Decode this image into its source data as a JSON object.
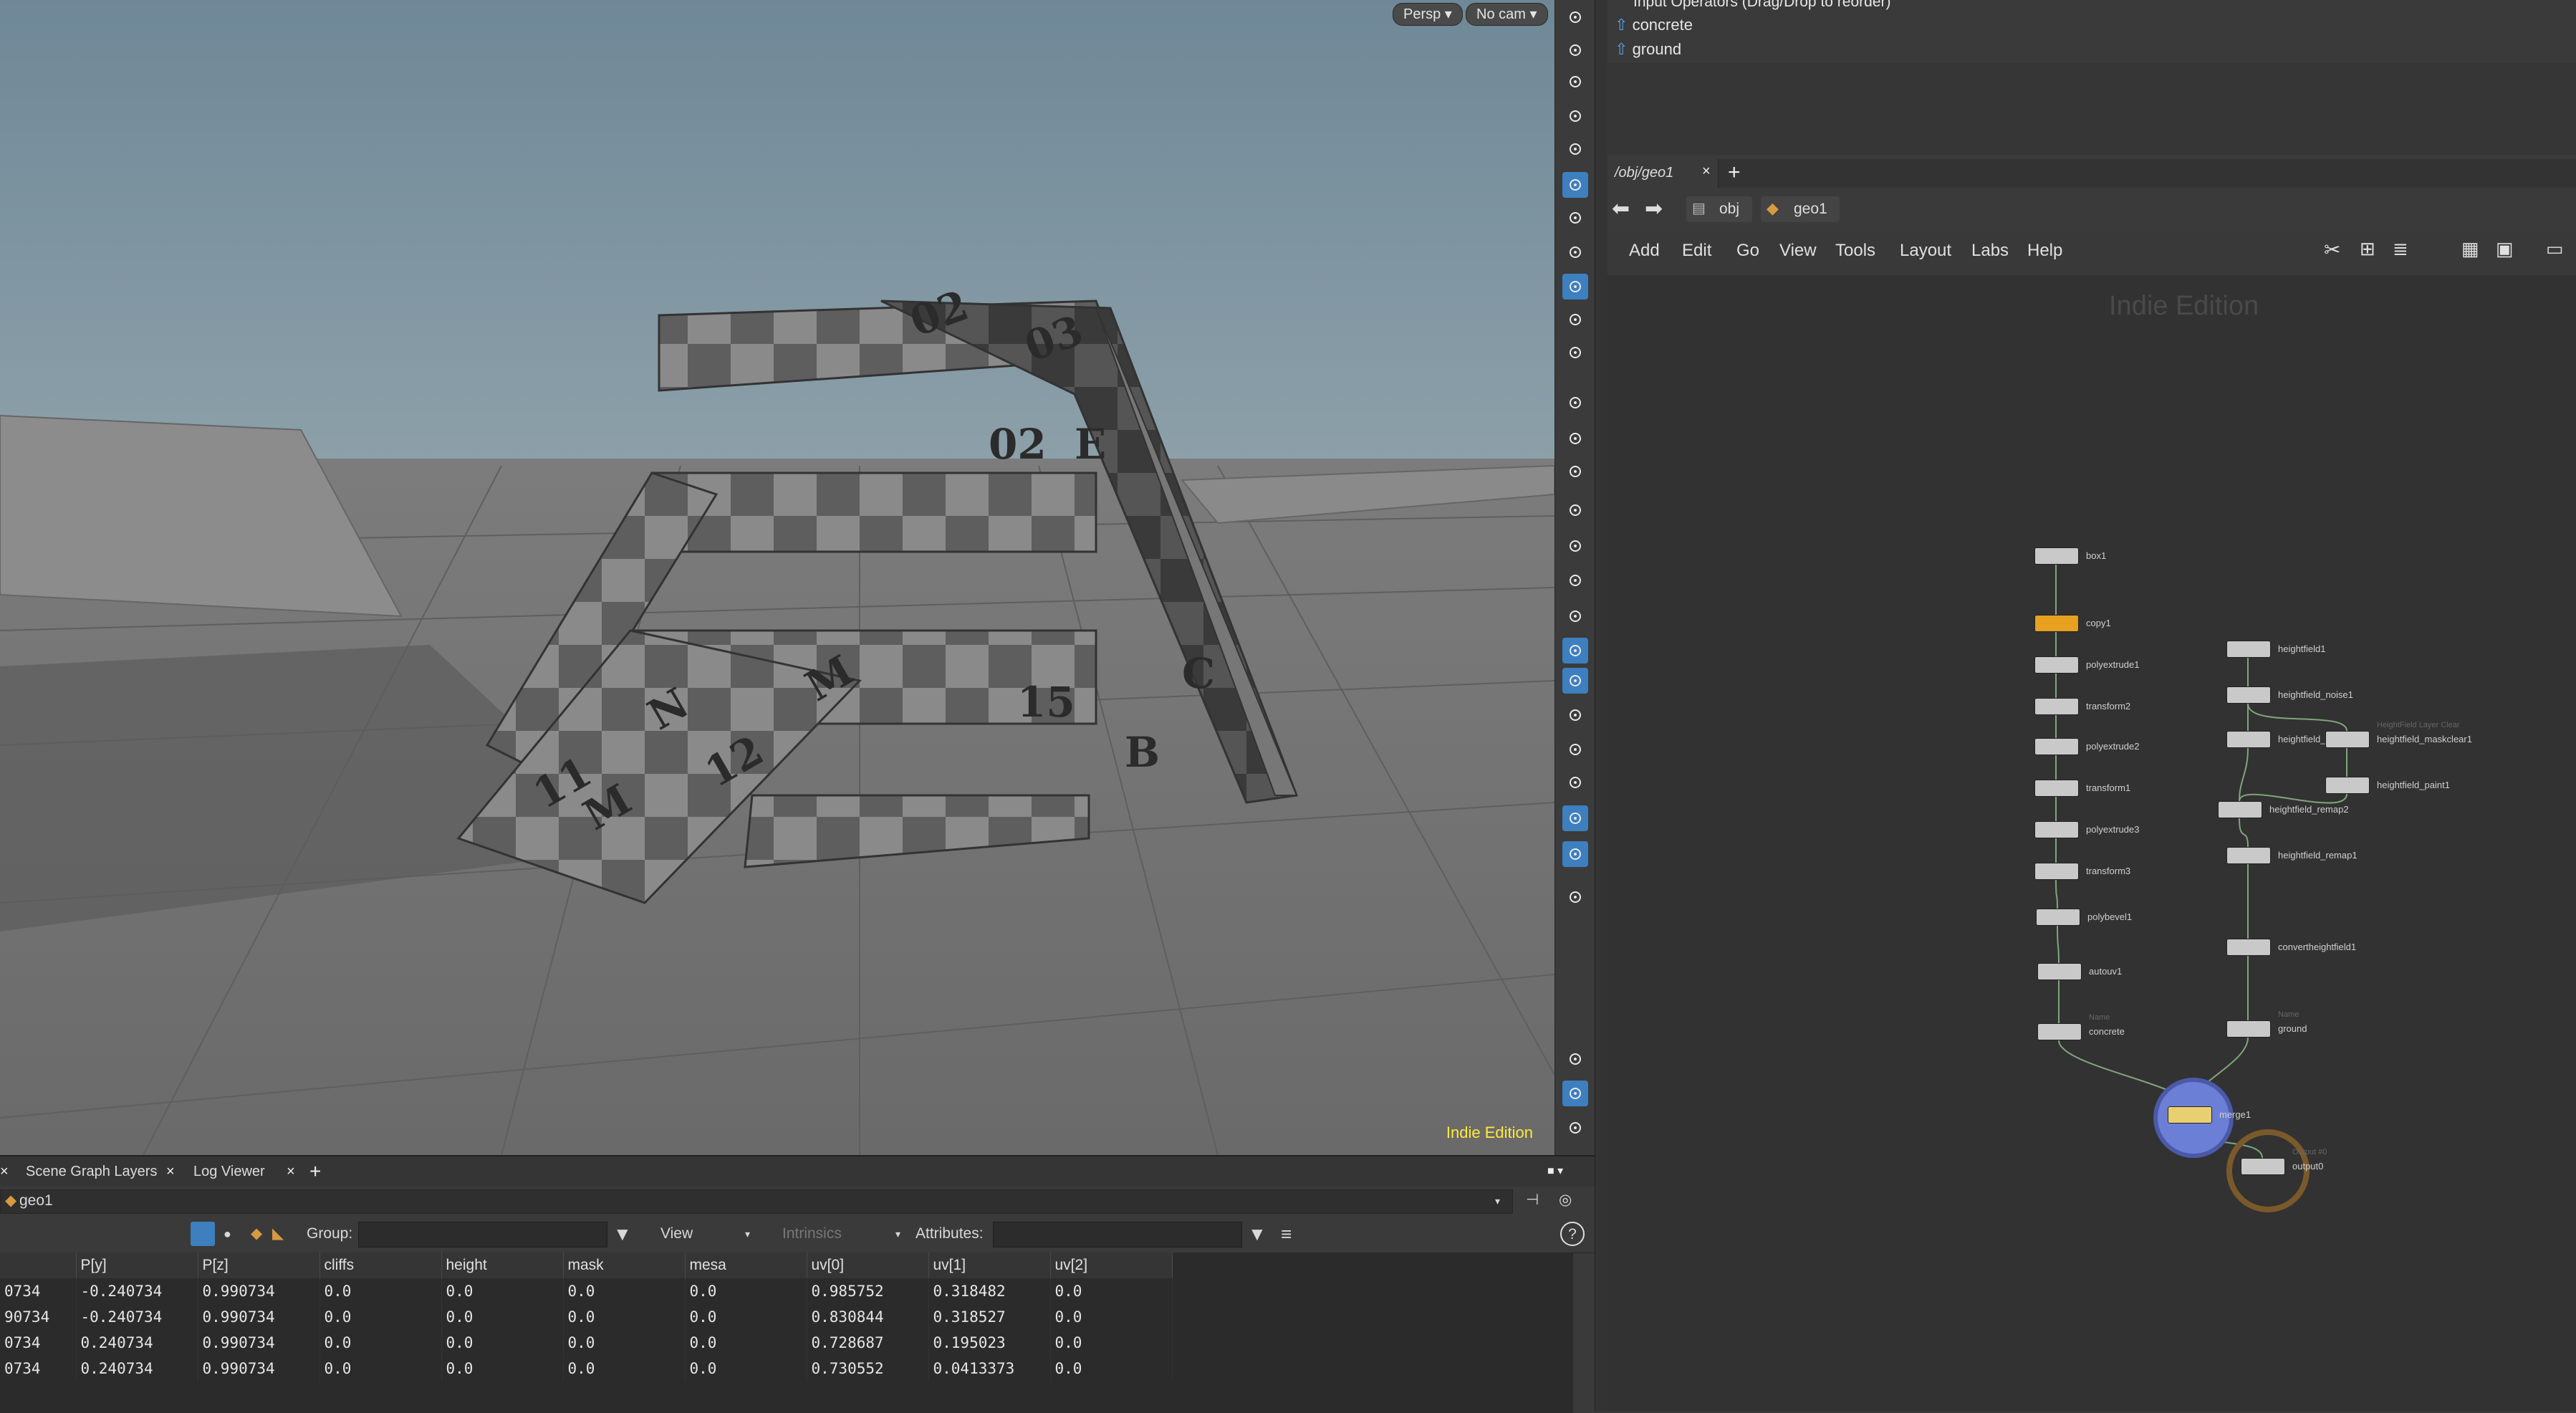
{
  "viewport": {
    "camera_persp": "Persp",
    "camera_nocam": "No cam",
    "watermark": "Indie Edition"
  },
  "toolbar_icons": [
    "view-tool-icon",
    "select-tool-icon",
    "lock-icon",
    "close-circle-icon",
    "ghost-icon",
    "bulb-icon",
    "light-icon",
    "headlight-icon",
    "camera-icon",
    "camera-view-icon",
    "camera-flag-icon",
    "point-icon",
    "brush-icon",
    "pen-icon",
    "numbered-points-icon",
    "primitive-icon",
    "numbered-prims-icon",
    "angle-icon",
    "shading-icon",
    "checker-icon",
    "solid-icon",
    "texture-icon",
    "paint-icon",
    "layers-icon",
    "background-icon",
    "pin-icon",
    "info-icon",
    "grid-layout-icon",
    "eye-icon"
  ],
  "bottom_panel": {
    "tabs": [
      {
        "label": "Scene Graph Layers"
      },
      {
        "label": "Log Viewer"
      }
    ],
    "path": "geo1",
    "group_label": "Group:",
    "view_label": "View",
    "intrinsics_label": "Intrinsics",
    "attributes_label": "Attributes:",
    "columns": [
      "",
      "P[y]",
      "P[z]",
      "cliffs",
      "height",
      "mask",
      "mesa",
      "uv[0]",
      "uv[1]",
      "uv[2]"
    ],
    "rows": [
      [
        "0734",
        "-0.240734",
        "0.990734",
        "0.0",
        "0.0",
        "0.0",
        "0.0",
        "0.985752",
        "0.318482",
        "0.0"
      ],
      [
        "90734",
        "-0.240734",
        "0.990734",
        "0.0",
        "0.0",
        "0.0",
        "0.0",
        "0.830844",
        "0.318527",
        "0.0"
      ],
      [
        "0734",
        "0.240734",
        "0.990734",
        "0.0",
        "0.0",
        "0.0",
        "0.0",
        "0.728687",
        "0.195023",
        "0.0"
      ],
      [
        "0734",
        "0.240734",
        "0.990734",
        "0.0",
        "0.0",
        "0.0",
        "0.0",
        "0.730552",
        "0.0413373",
        "0.0"
      ]
    ]
  },
  "params": {
    "header": "Input Operators (Drag/Drop to reorder)",
    "inputs": [
      "concrete",
      "ground"
    ]
  },
  "network": {
    "tab_label": "/obj/geo1",
    "breadcrumb": [
      "obj",
      "geo1"
    ],
    "menu": [
      "Add",
      "Edit",
      "Go",
      "View",
      "Tools",
      "Layout",
      "Labs",
      "Help"
    ],
    "watermark": "Indie Edition",
    "nodes": [
      {
        "name": "box1",
        "sub": "",
        "state": "normal"
      },
      {
        "name": "copy1",
        "sub": "",
        "state": "display"
      },
      {
        "name": "polyextrude1",
        "sub": "",
        "state": "normal"
      },
      {
        "name": "transform2",
        "sub": "",
        "state": "normal"
      },
      {
        "name": "polyextrude2",
        "sub": "",
        "state": "normal"
      },
      {
        "name": "transform1",
        "sub": "",
        "state": "normal"
      },
      {
        "name": "polyextrude3",
        "sub": "",
        "state": "normal"
      },
      {
        "name": "transform3",
        "sub": "",
        "state": "normal"
      },
      {
        "name": "polybevel1",
        "sub": "",
        "state": "normal"
      },
      {
        "name": "autouv1",
        "sub": "",
        "state": "normal"
      },
      {
        "name": "concrete",
        "sub": "Name",
        "state": "normal"
      },
      {
        "name": "heightfield1",
        "sub": "",
        "state": "normal"
      },
      {
        "name": "heightfield_noise1",
        "sub": "",
        "state": "normal"
      },
      {
        "name": "heightfield_te",
        "sub": "",
        "state": "normal"
      },
      {
        "name": "heightfield_maskclear1",
        "sub": "HeightField Layer Clear",
        "state": "normal"
      },
      {
        "name": "heightfield_paint1",
        "sub": "",
        "state": "normal"
      },
      {
        "name": "heightfield_remap2",
        "sub": "",
        "state": "normal"
      },
      {
        "name": "heightfield_remap1",
        "sub": "",
        "state": "normal"
      },
      {
        "name": "convertheightfield1",
        "sub": "",
        "state": "normal"
      },
      {
        "name": "ground",
        "sub": "Name",
        "state": "normal"
      },
      {
        "name": "merge1",
        "sub": "",
        "state": "selected"
      },
      {
        "name": "output0",
        "sub": "Output #0",
        "state": "output"
      }
    ]
  }
}
